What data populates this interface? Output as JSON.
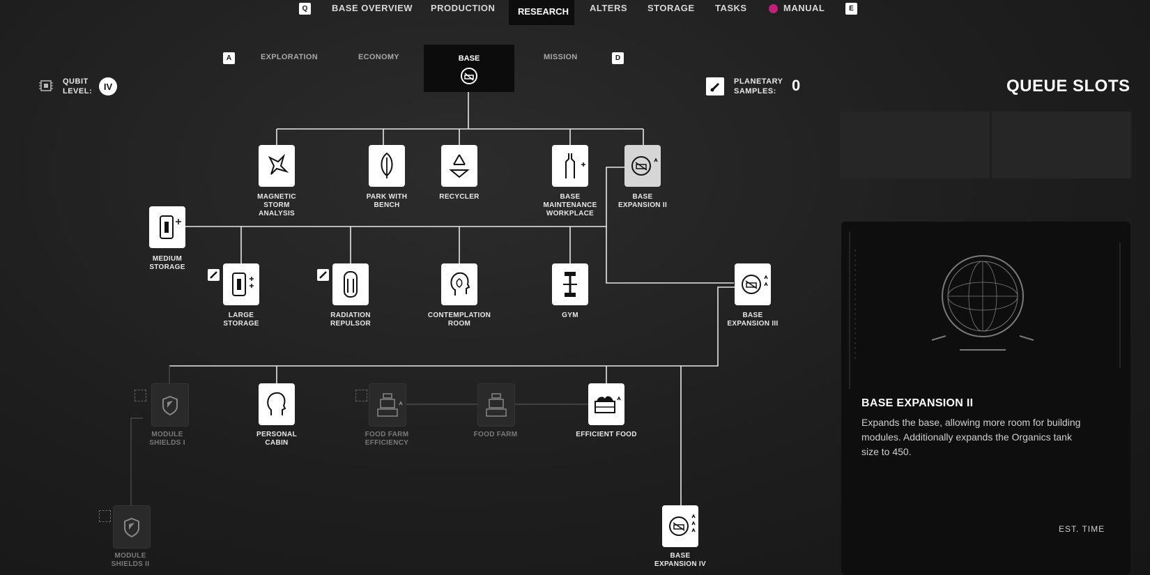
{
  "topnav": {
    "key_left": "Q",
    "key_right": "E",
    "items": [
      "BASE OVERVIEW",
      "PRODUCTION",
      "RESEARCH",
      "ALTERS",
      "STORAGE",
      "TASKS",
      "MANUAL"
    ],
    "active": "RESEARCH"
  },
  "subtabs": {
    "key_left": "A",
    "key_right": "D",
    "items": [
      "EXPLORATION",
      "ECONOMY",
      "BASE",
      "MISSION"
    ],
    "active": "BASE"
  },
  "qubit": {
    "label_line1": "QUBIT",
    "label_line2": "LEVEL:",
    "value": "IV"
  },
  "samples": {
    "label_line1": "PLANETARY",
    "label_line2": "SAMPLES:",
    "value": "0"
  },
  "queue": {
    "title": "QUEUE SLOTS"
  },
  "nodes": {
    "magnetic_storm": {
      "l1": "MAGNETIC",
      "l2": "STORM",
      "l3": "ANALYSIS"
    },
    "park_bench": {
      "l1": "PARK WITH",
      "l2": "BENCH"
    },
    "recycler": {
      "l1": "RECYCLER"
    },
    "base_maintenance": {
      "l1": "BASE",
      "l2": "MAINTENANCE",
      "l3": "WORKPLACE"
    },
    "base_expansion_2": {
      "l1": "BASE",
      "l2": "EXPANSION II"
    },
    "medium_storage": {
      "l1": "MEDIUM",
      "l2": "STORAGE"
    },
    "large_storage": {
      "l1": "LARGE",
      "l2": "STORAGE"
    },
    "radiation_repulsor": {
      "l1": "RADIATION",
      "l2": "REPULSOR"
    },
    "contemplation_room": {
      "l1": "CONTEMPLATION",
      "l2": "ROOM"
    },
    "gym": {
      "l1": "GYM"
    },
    "base_expansion_3": {
      "l1": "BASE",
      "l2": "EXPANSION III"
    },
    "module_shields_1": {
      "l1": "MODULE",
      "l2": "SHIELDS I"
    },
    "personal_cabin": {
      "l1": "PERSONAL",
      "l2": "CABIN"
    },
    "food_farm_efficiency": {
      "l1": "FOOD FARM",
      "l2": "EFFICIENCY"
    },
    "food_farm": {
      "l1": "FOOD FARM"
    },
    "efficient_food": {
      "l1": "EFFICIENT FOOD"
    },
    "module_shields_2": {
      "l1": "MODULE",
      "l2": "SHIELDS II"
    },
    "base_expansion_4": {
      "l1": "BASE",
      "l2": "EXPANSION IV"
    }
  },
  "detail": {
    "title": "BASE EXPANSION II",
    "description": "Expands the base, allowing more room for building modules. Additionally expands the Organics tank size to 450.",
    "est_time_label": "EST. TIME"
  },
  "colors": {
    "accent_pink": "#c0207a",
    "background": "#1f1f1f",
    "node_white": "#ffffff"
  }
}
